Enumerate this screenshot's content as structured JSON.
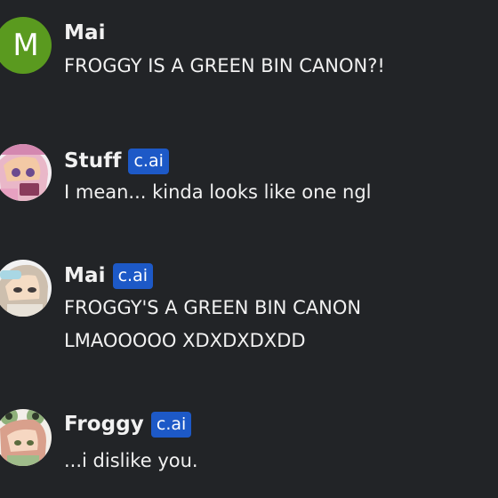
{
  "messages": [
    {
      "author": "Mai",
      "avatar_letter": "M",
      "avatar_color": "#5a9a1f",
      "text": "FROGGY IS A GREEN BIN CANON?!"
    },
    {
      "author": "Stuff",
      "badge": "c.ai",
      "text": "I mean... kinda looks like one ngl"
    },
    {
      "author": "Mai",
      "badge": "c.ai",
      "text": "FROGGY'S A GREEN BIN CANON\nLMAOOOOO XDXDXDXDD"
    },
    {
      "author": "Froggy",
      "badge": "c.ai",
      "text": "...i dislike you."
    }
  ],
  "colors": {
    "background": "#222427",
    "badge": "#1d59c7",
    "text": "#f1f1f1"
  }
}
